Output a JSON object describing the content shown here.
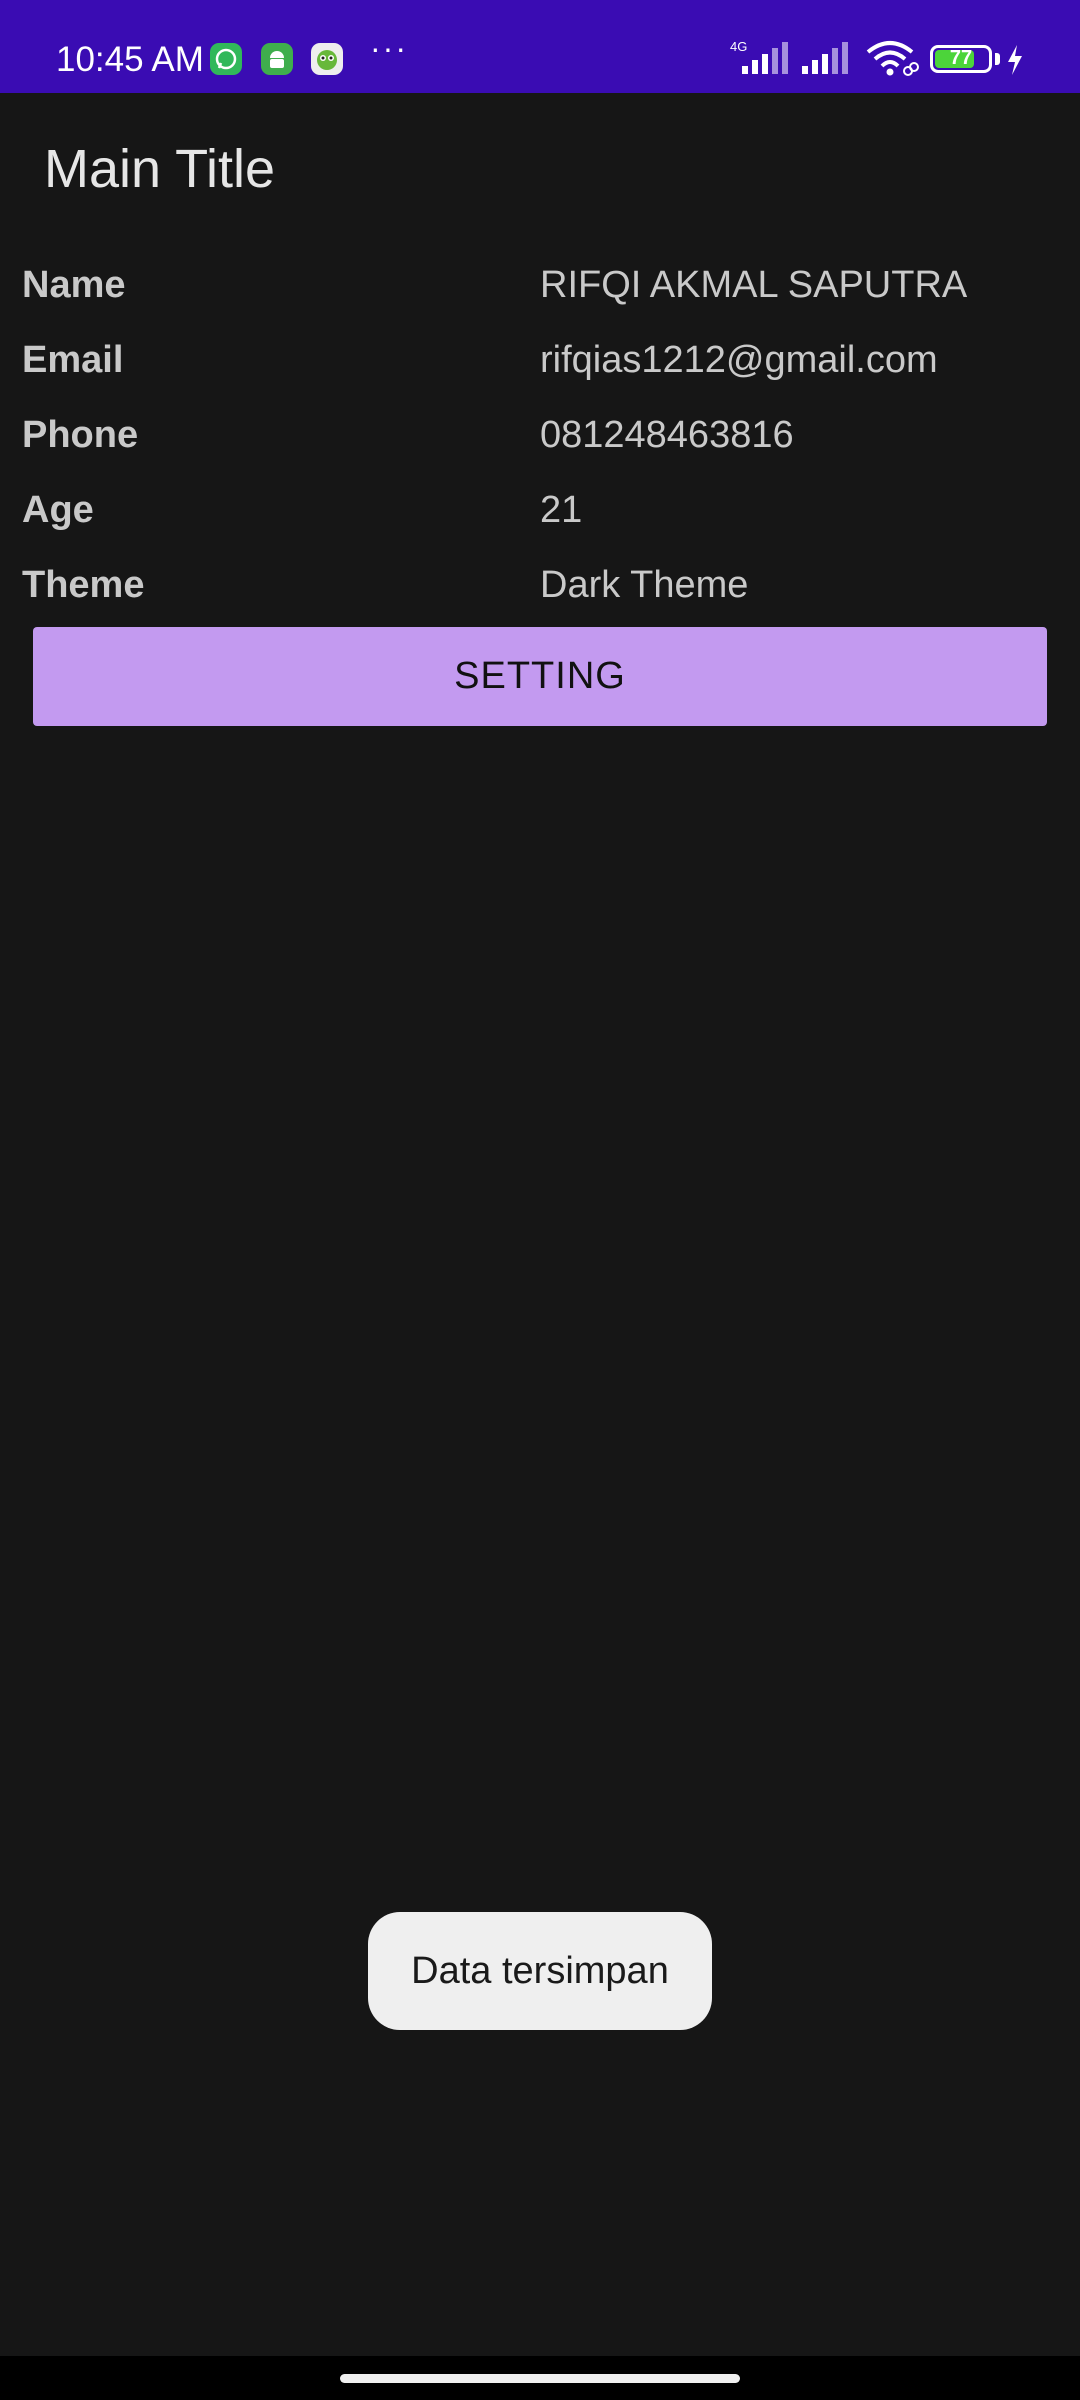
{
  "status_bar": {
    "time": "10:45 AM",
    "more": "···",
    "network_type": "4G",
    "battery_level": "77",
    "battery_fraction": 0.77,
    "icons": [
      "whatsapp-icon",
      "android-icon",
      "app-icon",
      "signal-icon",
      "signal-icon",
      "wifi-icon",
      "battery-icon",
      "charging-icon"
    ],
    "colors": {
      "background": "#3a0cb3",
      "battery": "#4cd43a"
    }
  },
  "app": {
    "title": "Main Title",
    "rows": [
      {
        "label": "Name",
        "value": "RIFQI AKMAL SAPUTRA"
      },
      {
        "label": "Email",
        "value": "rifqias1212@gmail.com"
      },
      {
        "label": "Phone",
        "value": "081248463816"
      },
      {
        "label": "Age",
        "value": "21"
      },
      {
        "label": "Theme",
        "value": "Dark Theme"
      }
    ],
    "setting_button": "SETTING",
    "colors": {
      "background": "#161616",
      "button": "#c39af0"
    }
  },
  "toast": {
    "message": "Data tersimpan"
  }
}
